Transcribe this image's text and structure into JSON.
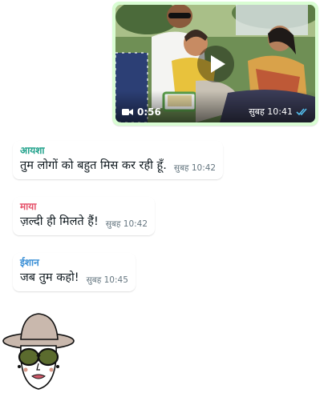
{
  "video_message": {
    "duration": "0:56",
    "time": "सुबह 10:41",
    "icons": {
      "camera": "videocam-icon",
      "play": "play-icon",
      "status": "double-check-icon"
    },
    "status_color": "#53bdeb"
  },
  "messages": [
    {
      "sender": "आयशा",
      "sender_color": "#1fa18a",
      "text": "तुम लोगों को बहुत मिस कर रही हूँ.",
      "time": "सुबह 10:42"
    },
    {
      "sender": "माया",
      "sender_color": "#e5526a",
      "text": "ज़ल्दी ही मिलते हैं!",
      "time": "सुबह 10:42"
    },
    {
      "sender": "ईशान",
      "sender_color": "#3a8fd6",
      "text": "जब तुम कहो!",
      "time": "सुबह 10:45"
    }
  ],
  "colors": {
    "outgoing_bubble": "#d9fdd3",
    "incoming_bubble": "#ffffff",
    "meta_text": "#667781"
  },
  "sticker": {
    "icon": "hat-lady-sticker-icon"
  }
}
